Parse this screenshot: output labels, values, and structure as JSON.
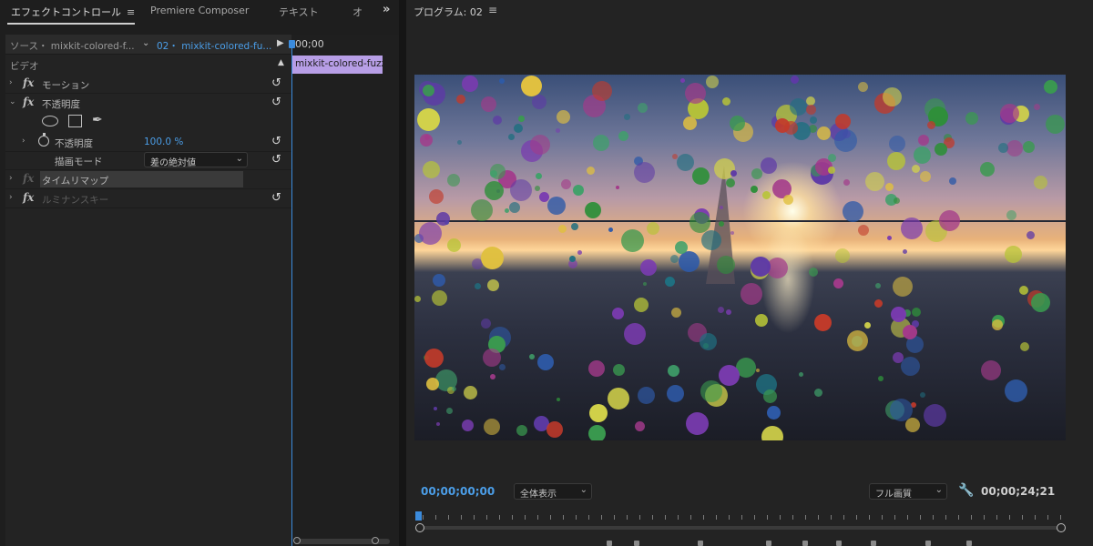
{
  "left_tabs": {
    "effect_controls": "エフェクトコントロール",
    "menu_glyph": "≡",
    "premiere_composer": "Premiere Composer",
    "text": "テキスト",
    "overflow_tab": "オ",
    "more": "»"
  },
  "effect_controls": {
    "source_label": "ソース・ mixkit-colored-f...",
    "sequence_label": "02・ mixkit-colored-fu...",
    "video_section": "ビデオ",
    "effects": [
      {
        "name": "モーション"
      },
      {
        "name": "不透明度"
      },
      {
        "name": "タイムリマップ"
      },
      {
        "name": "ルミナンスキー"
      }
    ],
    "opacity_param": {
      "label": "不透明度",
      "value": "100.0 %"
    },
    "blend_mode": {
      "label": "描画モード",
      "value": "差の絶対値"
    },
    "fx_icon": "fx",
    "reset_icon": "↺"
  },
  "timeline": {
    "time": "00;00",
    "clip_name": "mixkit-colored-fuzz"
  },
  "program": {
    "title": "プログラム: 02",
    "menu_glyph": "≡",
    "timecode_current": "00;00;00;00",
    "zoom_select": "全体表示",
    "quality_select": "フル画質",
    "timecode_duration": "00;00;24;21"
  },
  "colors": {
    "accent_blue": "#4b9ee8",
    "clip_purple": "#b79ee6"
  }
}
